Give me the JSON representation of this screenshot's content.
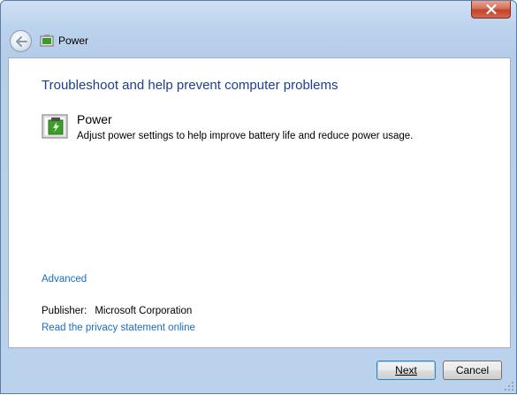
{
  "window": {
    "title": "Power"
  },
  "content": {
    "heading": "Troubleshoot and help prevent computer problems",
    "item": {
      "title": "Power",
      "description": "Adjust power settings to help improve battery life and reduce power usage.",
      "icon": "power-battery-icon"
    },
    "advanced_link": "Advanced",
    "publisher_label": "Publisher:",
    "publisher_value": "Microsoft Corporation",
    "privacy_link": "Read the privacy statement online"
  },
  "footer": {
    "next_label": "Next",
    "cancel_label": "Cancel"
  },
  "colors": {
    "heading": "#1c3e94",
    "link": "#1a6dc5",
    "frame": "#bcd3ee",
    "close": "#c4412a"
  }
}
